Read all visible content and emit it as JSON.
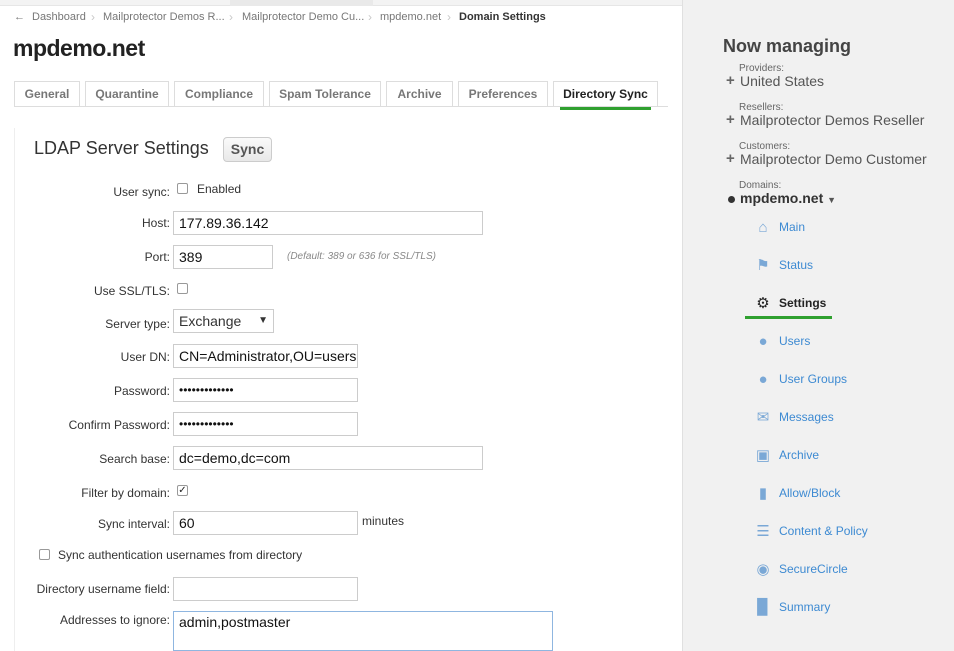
{
  "breadcrumb": {
    "items": [
      "Dashboard",
      "Mailprotector Demos R...",
      "Mailprotector Demo Cu...",
      "mpdemo.net",
      "Domain Settings"
    ],
    "separator": "›"
  },
  "page": {
    "title": "mpdemo.net"
  },
  "tabs": [
    "General",
    "Quarantine",
    "Compliance",
    "Spam Tolerance",
    "Archive",
    "Preferences",
    "Directory Sync"
  ],
  "active_tab": "Directory Sync",
  "ldap": {
    "section_title": "LDAP Server Settings",
    "sync_button": "Sync",
    "user_sync": {
      "label": "User sync:",
      "checkbox_label": "Enabled",
      "checked": false
    },
    "host": {
      "label": "Host:",
      "value": "177.89.36.142"
    },
    "port": {
      "label": "Port:",
      "value": "389",
      "hint": "(Default: 389 or 636 for SSL/TLS)"
    },
    "ssl": {
      "label": "Use SSL/TLS:",
      "checked": false
    },
    "server_type": {
      "label": "Server type:",
      "value": "Exchange"
    },
    "user_dn": {
      "label": "User DN:",
      "value": "CN=Administrator,OU=users"
    },
    "password": {
      "label": "Password:",
      "value": "•••••••••••••"
    },
    "confirm_password": {
      "label": "Confirm Password:",
      "value": "•••••••••••••"
    },
    "search_base": {
      "label": "Search base:",
      "value": "dc=demo,dc=com"
    },
    "filter_domain": {
      "label": "Filter by domain:",
      "checked": true
    },
    "sync_interval": {
      "label": "Sync interval:",
      "value": "60",
      "unit": "minutes"
    },
    "sync_auth": {
      "label": "Sync authentication usernames from directory",
      "checked": false
    },
    "dir_username_field": {
      "label": "Directory username field:",
      "value": ""
    },
    "addresses_ignore": {
      "label": "Addresses to ignore:",
      "value": "admin,postmaster"
    }
  },
  "sidebar": {
    "heading": "Now managing",
    "providers": {
      "label": "Providers:",
      "value": "United States"
    },
    "resellers": {
      "label": "Resellers:",
      "value": "Mailprotector Demos Reseller"
    },
    "customers": {
      "label": "Customers:",
      "value": "Mailprotector Demo Customer"
    },
    "domains": {
      "label": "Domains:",
      "value": "mpdemo.net"
    },
    "menu": [
      {
        "label": "Main",
        "icon": "home-icon"
      },
      {
        "label": "Status",
        "icon": "flag-icon"
      },
      {
        "label": "Settings",
        "icon": "gear-icon",
        "active": true
      },
      {
        "label": "Users",
        "icon": "user-icon"
      },
      {
        "label": "User Groups",
        "icon": "user-groups-icon"
      },
      {
        "label": "Messages",
        "icon": "envelope-icon"
      },
      {
        "label": "Archive",
        "icon": "archive-icon"
      },
      {
        "label": "Allow/Block",
        "icon": "door-icon"
      },
      {
        "label": "Content & Policy",
        "icon": "document-icon"
      },
      {
        "label": "SecureCircle",
        "icon": "securecircle-icon"
      },
      {
        "label": "Summary",
        "icon": "bar-chart-icon"
      }
    ]
  },
  "colors": {
    "accent": "#2fa02f",
    "link": "#3d8ad2",
    "sidebar_bg": "#f1f1f1"
  }
}
